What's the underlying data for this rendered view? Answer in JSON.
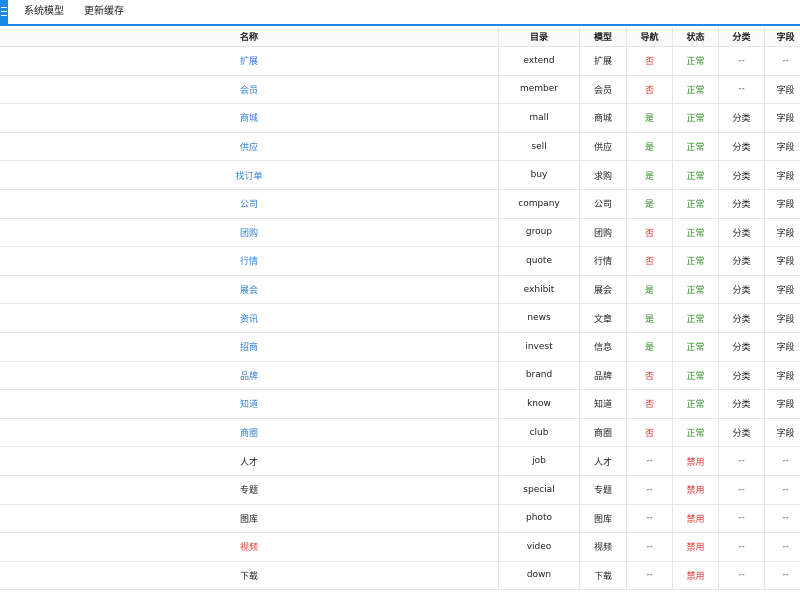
{
  "tabs": [
    {
      "label": "系统模型"
    },
    {
      "label": "更新缓存"
    }
  ],
  "colors": {
    "accent": "#1e88e5",
    "link": "#2f7ed8",
    "yes": "#2e8b22",
    "no": "#e53935"
  },
  "table": {
    "headers": {
      "name": "名称",
      "dir": "目录",
      "model": "模型",
      "nav": "导航",
      "status": "状态",
      "category": "分类",
      "field": "字段"
    },
    "rows": [
      {
        "name": "扩展",
        "name_style": "link",
        "dir": "extend",
        "model": "扩展",
        "nav": "否",
        "nav_style": "red",
        "status": "正常",
        "status_style": "green",
        "category": "--",
        "field": "--"
      },
      {
        "name": "会员",
        "name_style": "link",
        "dir": "member",
        "model": "会员",
        "nav": "否",
        "nav_style": "red",
        "status": "正常",
        "status_style": "green",
        "category": "--",
        "field": "字段"
      },
      {
        "name": "商城",
        "name_style": "link",
        "dir": "mall",
        "model": "商城",
        "nav": "是",
        "nav_style": "green",
        "status": "正常",
        "status_style": "green",
        "category": "分类",
        "field": "字段"
      },
      {
        "name": "供应",
        "name_style": "link",
        "dir": "sell",
        "model": "供应",
        "nav": "是",
        "nav_style": "green",
        "status": "正常",
        "status_style": "green",
        "category": "分类",
        "field": "字段"
      },
      {
        "name": "找订单",
        "name_style": "link",
        "dir": "buy",
        "model": "求购",
        "nav": "是",
        "nav_style": "green",
        "status": "正常",
        "status_style": "green",
        "category": "分类",
        "field": "字段"
      },
      {
        "name": "公司",
        "name_style": "link",
        "dir": "company",
        "model": "公司",
        "nav": "是",
        "nav_style": "green",
        "status": "正常",
        "status_style": "green",
        "category": "分类",
        "field": "字段"
      },
      {
        "name": "团购",
        "name_style": "link",
        "dir": "group",
        "model": "团购",
        "nav": "否",
        "nav_style": "red",
        "status": "正常",
        "status_style": "green",
        "category": "分类",
        "field": "字段"
      },
      {
        "name": "行情",
        "name_style": "link",
        "dir": "quote",
        "model": "行情",
        "nav": "否",
        "nav_style": "red",
        "status": "正常",
        "status_style": "green",
        "category": "分类",
        "field": "字段"
      },
      {
        "name": "展会",
        "name_style": "link",
        "dir": "exhibit",
        "model": "展会",
        "nav": "是",
        "nav_style": "green",
        "status": "正常",
        "status_style": "green",
        "category": "分类",
        "field": "字段"
      },
      {
        "name": "资讯",
        "name_style": "link",
        "dir": "news",
        "model": "文章",
        "nav": "是",
        "nav_style": "green",
        "status": "正常",
        "status_style": "green",
        "category": "分类",
        "field": "字段"
      },
      {
        "name": "招商",
        "name_style": "link",
        "dir": "invest",
        "model": "信息",
        "nav": "是",
        "nav_style": "green",
        "status": "正常",
        "status_style": "green",
        "category": "分类",
        "field": "字段"
      },
      {
        "name": "品牌",
        "name_style": "link",
        "dir": "brand",
        "model": "品牌",
        "nav": "否",
        "nav_style": "red",
        "status": "正常",
        "status_style": "green",
        "category": "分类",
        "field": "字段"
      },
      {
        "name": "知道",
        "name_style": "link",
        "dir": "know",
        "model": "知道",
        "nav": "否",
        "nav_style": "red",
        "status": "正常",
        "status_style": "green",
        "category": "分类",
        "field": "字段"
      },
      {
        "name": "商圈",
        "name_style": "link",
        "dir": "club",
        "model": "商圈",
        "nav": "否",
        "nav_style": "red",
        "status": "正常",
        "status_style": "green",
        "category": "分类",
        "field": "字段"
      },
      {
        "name": "人才",
        "name_style": "plain",
        "dir": "job",
        "model": "人才",
        "nav": "--",
        "nav_style": "muted",
        "status": "禁用",
        "status_style": "red",
        "category": "--",
        "field": "--"
      },
      {
        "name": "专题",
        "name_style": "plain",
        "dir": "special",
        "model": "专题",
        "nav": "--",
        "nav_style": "muted",
        "status": "禁用",
        "status_style": "red",
        "category": "--",
        "field": "--"
      },
      {
        "name": "图库",
        "name_style": "plain",
        "dir": "photo",
        "model": "图库",
        "nav": "--",
        "nav_style": "muted",
        "status": "禁用",
        "status_style": "red",
        "category": "--",
        "field": "--"
      },
      {
        "name": "视频",
        "name_style": "red",
        "dir": "video",
        "model": "视频",
        "nav": "--",
        "nav_style": "muted",
        "status": "禁用",
        "status_style": "red",
        "category": "--",
        "field": "--"
      },
      {
        "name": "下载",
        "name_style": "plain",
        "dir": "down",
        "model": "下载",
        "nav": "--",
        "nav_style": "muted",
        "status": "禁用",
        "status_style": "red",
        "category": "--",
        "field": "--"
      }
    ]
  }
}
